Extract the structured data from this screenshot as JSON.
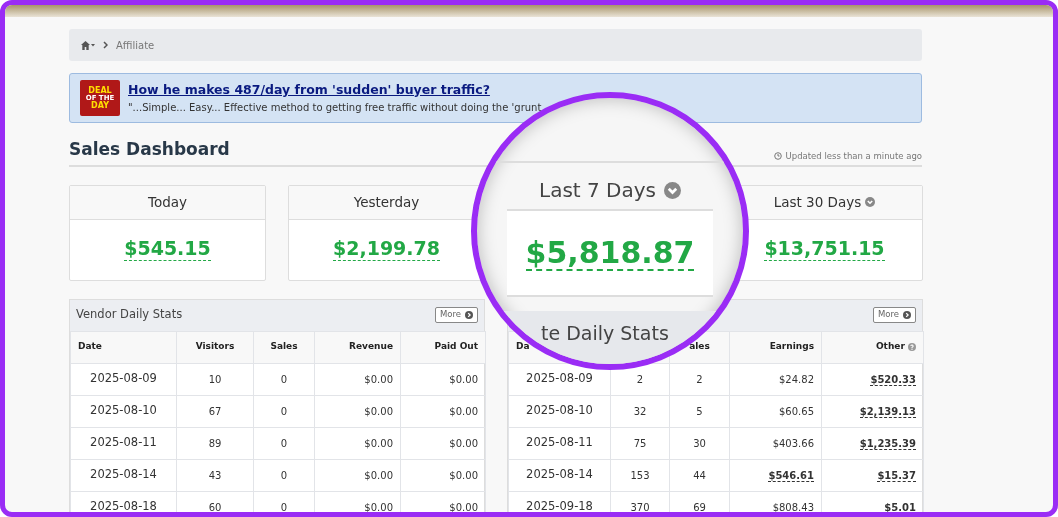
{
  "breadcrumb": {
    "current": "Affiliate"
  },
  "deal": {
    "logo": [
      "DEAL",
      "OF THE",
      "DAY"
    ],
    "headline": "How he makes 487/day from 'sudden' buyer traffic?",
    "teaser": "\"...Simple... Easy... Effective method to getting free traffic without doing the 'grunt"
  },
  "page_title": "Sales Dashboard",
  "updated": "Updated less than a minute ago",
  "cards": [
    {
      "title": "Today",
      "value": "$545.15",
      "dropdown": false
    },
    {
      "title": "Yesterday",
      "value": "$2,199.78",
      "dropdown": false
    },
    {
      "title": "Last 30 Days",
      "value": "$13,751.15",
      "dropdown": true
    }
  ],
  "magnifier": {
    "card_title": "Last 7 Days",
    "card_dropdown": true,
    "card_value": "$5,818.87",
    "panel_title": "te Daily Stats"
  },
  "vendor": {
    "title": "Vendor Daily Stats",
    "more": "More",
    "columns": [
      {
        "label": "Date"
      },
      {
        "label": "Visitors"
      },
      {
        "label": "Sales"
      },
      {
        "label": "Revenue"
      },
      {
        "label": "Paid Out"
      }
    ],
    "rows": [
      [
        "2025-08-09",
        "10",
        "0",
        "$0.00",
        "$0.00"
      ],
      [
        "2025-08-10",
        "67",
        "0",
        "$0.00",
        "$0.00"
      ],
      [
        "2025-08-11",
        "89",
        "0",
        "$0.00",
        "$0.00"
      ],
      [
        "2025-08-14",
        "43",
        "0",
        "$0.00",
        "$0.00"
      ],
      [
        "2025-08-18",
        "60",
        "0",
        "$0.00",
        "$0.00"
      ]
    ]
  },
  "affiliate": {
    "more": "More",
    "columns": [
      {
        "label": "Da",
        "help": false
      },
      {},
      {
        "label": "ales",
        "help": false
      },
      {
        "label": "Earnings",
        "help": false
      },
      {
        "label": "Other",
        "help": true
      }
    ],
    "rows": [
      {
        "date": "2025-08-09",
        "visitors": "2",
        "sales": "2",
        "earnings": {
          "text": "$24.82",
          "highlighted": false
        },
        "other": {
          "text": "$520.33",
          "highlighted": true
        }
      },
      {
        "date": "2025-08-10",
        "visitors": "32",
        "sales": "5",
        "earnings": {
          "text": "$60.65",
          "highlighted": false
        },
        "other": {
          "text": "$2,139.13",
          "highlighted": true
        }
      },
      {
        "date": "2025-08-11",
        "visitors": "75",
        "sales": "30",
        "earnings": {
          "text": "$403.66",
          "highlighted": false
        },
        "other": {
          "text": "$1,235.39",
          "highlighted": true
        }
      },
      {
        "date": "2025-08-14",
        "visitors": "153",
        "sales": "44",
        "earnings": {
          "text": "$546.61",
          "highlighted": true
        },
        "other": {
          "text": "$15.37",
          "highlighted": true
        }
      },
      {
        "date": "2025-09-18",
        "visitors": "370",
        "sales": "69",
        "earnings": {
          "text": "$808.43",
          "highlighted": false
        },
        "other": {
          "text": "$5.01",
          "highlighted": true
        }
      }
    ]
  }
}
